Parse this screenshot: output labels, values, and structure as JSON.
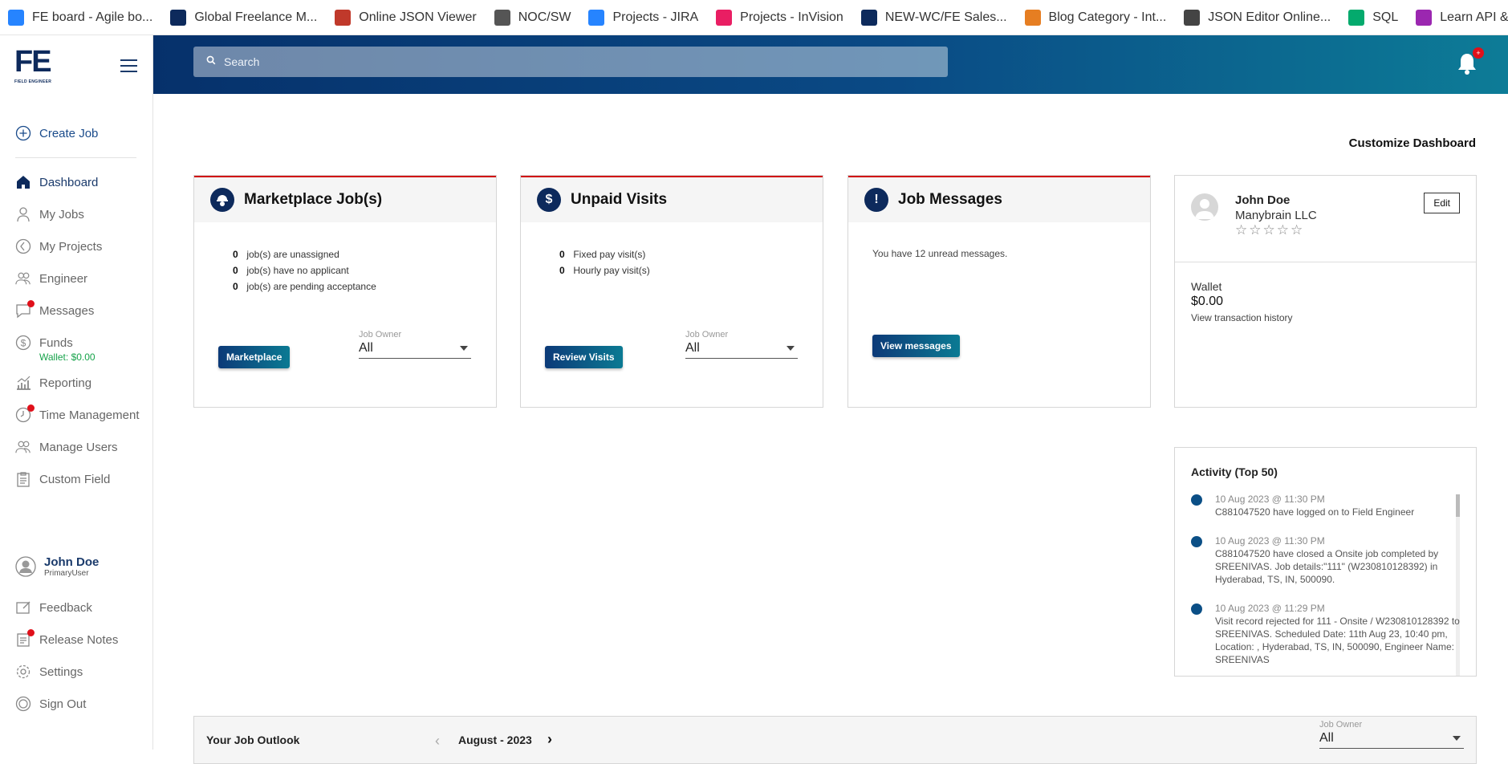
{
  "bookmarks": [
    {
      "label": "FE board - Agile bo...",
      "icon": "jira-diamond-icon",
      "color": "#2684ff"
    },
    {
      "label": "Global Freelance M...",
      "icon": "fe-logo-icon",
      "color": "#0d2a5c"
    },
    {
      "label": "Online JSON Viewer",
      "icon": "json-viewer-icon",
      "color": "#c0392b"
    },
    {
      "label": "NOC/SW",
      "icon": "noc-icon",
      "color": "#555555"
    },
    {
      "label": "Projects - JIRA",
      "icon": "jira-diamond-icon",
      "color": "#2684ff"
    },
    {
      "label": "Projects - InVision",
      "icon": "invision-icon",
      "color": "#e91e63"
    },
    {
      "label": "NEW-WC/FE Sales...",
      "icon": "fe-logo-icon",
      "color": "#0d2a5c"
    },
    {
      "label": "Blog Category - Int...",
      "icon": "blog-icon",
      "color": "#e67e22"
    },
    {
      "label": "JSON Editor Online...",
      "icon": "json-editor-icon",
      "color": "#444444"
    },
    {
      "label": "SQL",
      "icon": "w3schools-icon",
      "color": "#04aa6d"
    },
    {
      "label": "Learn API & Webse...",
      "icon": "learn-api-icon",
      "color": "#9b27b0"
    }
  ],
  "logo": {
    "text": "FE",
    "subtitle": "FIELD ENGINEER"
  },
  "sidebar": {
    "create_job": "Create Job",
    "items": [
      {
        "label": "Dashboard",
        "icon": "home-icon"
      },
      {
        "label": "My Jobs",
        "icon": "person-icon"
      },
      {
        "label": "My Projects",
        "icon": "projects-icon"
      },
      {
        "label": "Engineer",
        "icon": "engineer-icon"
      },
      {
        "label": "Messages",
        "icon": "chat-icon"
      },
      {
        "label": "Funds",
        "icon": "dollar-icon"
      },
      {
        "label": "Reporting",
        "icon": "bar-chart-icon"
      },
      {
        "label": "Time Management",
        "icon": "clock-icon"
      },
      {
        "label": "Manage Users",
        "icon": "users-icon"
      },
      {
        "label": "Custom Field",
        "icon": "clipboard-icon"
      }
    ],
    "wallet": "Wallet: $0.00",
    "user": {
      "name": "John Doe",
      "role": "PrimaryUser"
    },
    "bottom_items": [
      {
        "label": "Feedback",
        "icon": "feedback-icon"
      },
      {
        "label": "Release Notes",
        "icon": "release-notes-icon"
      },
      {
        "label": "Settings",
        "icon": "gear-icon"
      },
      {
        "label": "Sign Out",
        "icon": "power-icon"
      }
    ]
  },
  "header": {
    "search_placeholder": "Search",
    "notification_badge": "+"
  },
  "dashboard": {
    "customize": "Customize Dashboard",
    "marketplace": {
      "title": "Marketplace Job(s)",
      "stats": [
        {
          "count": "0",
          "text": "job(s) are unassigned"
        },
        {
          "count": "0",
          "text": "job(s) have no applicant"
        },
        {
          "count": "0",
          "text": "job(s) are pending acceptance"
        }
      ],
      "button": "Marketplace",
      "owner_label": "Job Owner",
      "owner_value": "All"
    },
    "unpaid": {
      "title": "Unpaid Visits",
      "stats": [
        {
          "count": "0",
          "text": "Fixed pay visit(s)"
        },
        {
          "count": "0",
          "text": "Hourly pay visit(s)"
        }
      ],
      "button": "Review Visits",
      "owner_label": "Job Owner",
      "owner_value": "All"
    },
    "messages": {
      "title": "Job Messages",
      "text": "You have 12 unread messages.",
      "button": "View messages"
    },
    "profile": {
      "name": "John Doe",
      "company": "Manybrain LLC",
      "stars": "☆☆☆☆☆",
      "edit": "Edit",
      "wallet_label": "Wallet",
      "wallet_amount": "$0.00",
      "history_link": "View transaction history"
    },
    "activity": {
      "title": "Activity (Top 50)",
      "items": [
        {
          "time": "10 Aug 2023 @ 11:30 PM",
          "text": "C881047520 have logged on to Field Engineer"
        },
        {
          "time": "10 Aug 2023 @ 11:30 PM",
          "text": "C881047520 have closed a Onsite job completed by SREENIVAS. Job details:\"111\" (W230810128392) in Hyderabad, TS, IN, 500090."
        },
        {
          "time": "10 Aug 2023 @ 11:29 PM",
          "text": "Visit record rejected for 111 - Onsite / W230810128392 to SREENIVAS. Scheduled Date: 11th Aug 23, 10:40 pm, Location: , Hyderabad, TS, IN, 500090, Engineer Name: SREENIVAS"
        }
      ]
    },
    "outlook": {
      "title": "Your Job Outlook",
      "month": "August - 2023",
      "owner_label": "Job Owner",
      "owner_value": "All"
    }
  }
}
